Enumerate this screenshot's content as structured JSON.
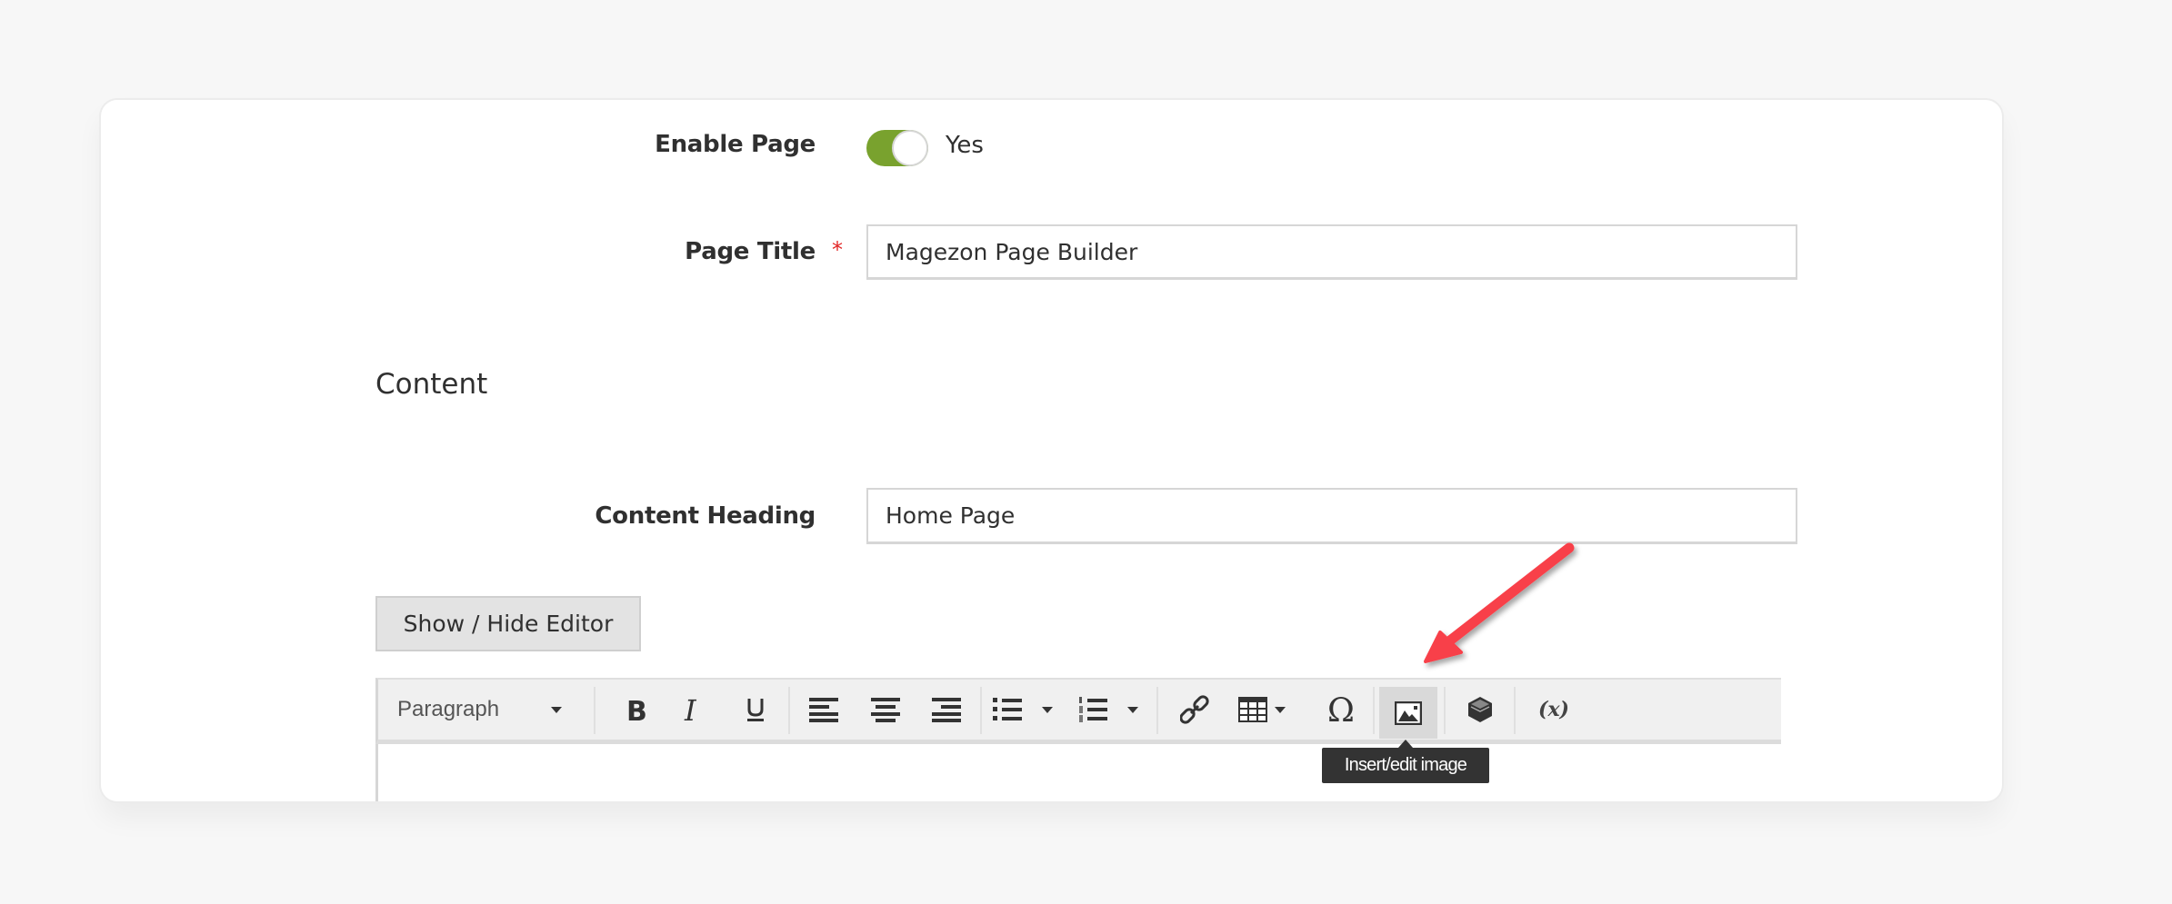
{
  "form": {
    "enable_page": {
      "label": "Enable Page",
      "value": true,
      "value_text": "Yes"
    },
    "page_title": {
      "label": "Page Title",
      "required_marker": "*",
      "value": "Magezon Page Builder"
    },
    "content_section": {
      "title": "Content"
    },
    "content_heading": {
      "label": "Content Heading",
      "value": "Home Page"
    },
    "show_hide_editor_label": "Show / Hide Editor"
  },
  "editor": {
    "toolbar": {
      "format_select": "Paragraph",
      "buttons": [
        {
          "name": "bold",
          "icon": "bold-icon"
        },
        {
          "name": "italic",
          "icon": "italic-icon"
        },
        {
          "name": "underline",
          "icon": "underline-icon"
        },
        {
          "name": "align-left",
          "icon": "align-left-icon"
        },
        {
          "name": "align-center",
          "icon": "align-center-icon"
        },
        {
          "name": "align-right",
          "icon": "align-right-icon"
        },
        {
          "name": "bullet-list",
          "icon": "bullet-list-icon",
          "dropdown": true
        },
        {
          "name": "numbered-list",
          "icon": "numbered-list-icon",
          "dropdown": true
        },
        {
          "name": "link",
          "icon": "link-icon"
        },
        {
          "name": "table",
          "icon": "table-icon",
          "dropdown": true
        },
        {
          "name": "special-character",
          "icon": "omega-icon"
        },
        {
          "name": "insert-image",
          "icon": "image-icon",
          "active": true
        },
        {
          "name": "insert-widget",
          "icon": "widget-icon"
        },
        {
          "name": "insert-variable",
          "icon": "variable-icon",
          "text": "(x)"
        }
      ]
    },
    "tooltip": "Insert/edit image"
  },
  "colors": {
    "toggle_on": "#79a22e",
    "required": "#e22626",
    "annotation_arrow": "#f8414a",
    "tooltip_bg": "#333333"
  }
}
